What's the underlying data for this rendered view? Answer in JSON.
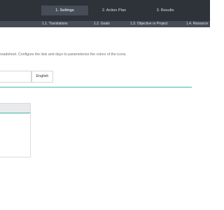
{
  "nav": {
    "main_tabs": [
      {
        "label": "1. Settings",
        "active": true
      },
      {
        "label": "2. Action Plan",
        "active": false
      },
      {
        "label": "3. Results",
        "active": false
      }
    ],
    "sub_tabs": [
      {
        "label": "1.1. Translations"
      },
      {
        "label": "1.2. Goals"
      },
      {
        "label": "1.3. Objective or Project"
      },
      {
        "label": "1.4. Resource"
      }
    ]
  },
  "content": {
    "description": "readsheet. Configure the lists and days to parameterize the colors of the icons.",
    "language_select": {
      "value": "English"
    },
    "text_input": {
      "value": ""
    }
  },
  "colors": {
    "topbar": "#2e333a",
    "subbar": "#464d57",
    "accent": "#3fb7aa"
  }
}
